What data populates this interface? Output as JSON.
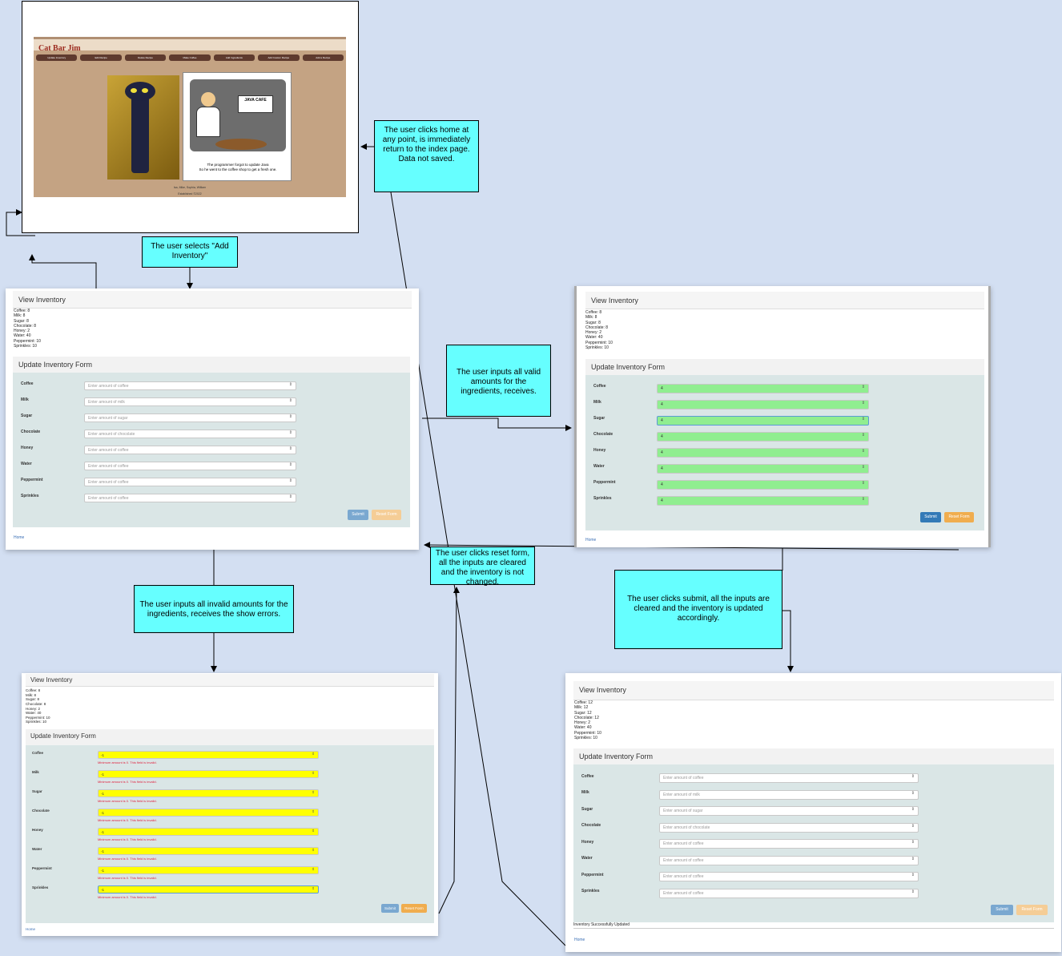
{
  "index": {
    "title": "Cat Bar Jim",
    "nav": [
      "Update Inventory",
      "Edit Recipe",
      "Delete Recipe",
      "Make Coffee",
      "Add Ingredients",
      "Add Custom Recipe",
      "Add a Recipe"
    ],
    "sign": "JAVA CAFE",
    "caption_line1": "The programmer forgot to update Java",
    "caption_line2": "So he went to the coffee shop to get a fresh one.",
    "authors": "Isa, Mike, Sophia, William",
    "established": "Established ©2022"
  },
  "callouts": {
    "home": "The user clicks home at any point, is immediately return to the index page. Data not saved.",
    "add_inventory": "The user selects \"Add Inventory\"",
    "valid": "The user inputs all valid amounts for the ingredients, receives.",
    "reset": "The user clicks reset form, all the inputs are cleared and the inventory is not changed.",
    "invalid": "The user inputs all invalid amounts for the ingredients, receives the show errors.",
    "submit": "The user clicks submit, all the inputs are cleared and the inventory is updated accordingly."
  },
  "form": {
    "view_title": "View Inventory",
    "form_title": "Update Inventory Form",
    "labels": [
      "Coffee",
      "Milk",
      "Sugar",
      "Chocolate",
      "Honey",
      "Water",
      "Peppermint",
      "Sprinkles"
    ],
    "placeholders": [
      "Enter amount of coffee",
      "Enter amount of milk",
      "Enter amount of sugar",
      "Enter amount of chocolate",
      "Enter amount of coffee",
      "Enter amount of coffee",
      "Enter amount of coffee",
      "Enter amount of coffee"
    ],
    "submit": "Submit",
    "reset": "Reset Form",
    "home": "Home",
    "error": "Minimum amount is 0. This field is invalid.",
    "success": "Inventory Successfully Updated"
  },
  "inventory_initial": [
    "Coffee: 8",
    "Milk: 8",
    "Sugar: 8",
    "Chocolate: 8",
    "Honey: 2",
    "Water: 40",
    "Peppermint: 10",
    "Sprinkles: 10"
  ],
  "inventory_invalid": [
    "Coffee: 8",
    "Milk: 8",
    "Sugar: 8",
    "Chocolate: 8",
    "Honey: 2",
    "Water: 40",
    "Peppermint: 10",
    "Sprinkles: 10"
  ],
  "inventory_updated": [
    "Coffee: 12",
    "Milk: 12",
    "Sugar: 12",
    "Chocolate: 12",
    "Honey: 2",
    "Water: 40",
    "Peppermint: 10",
    "Sprinkles: 10"
  ],
  "valid_value": "4",
  "invalid_value": "-1",
  "colors": {
    "callout": "#66ffff",
    "valid_input": "#90ee90",
    "invalid_input": "#ffff00",
    "background": "#d3dff2"
  }
}
